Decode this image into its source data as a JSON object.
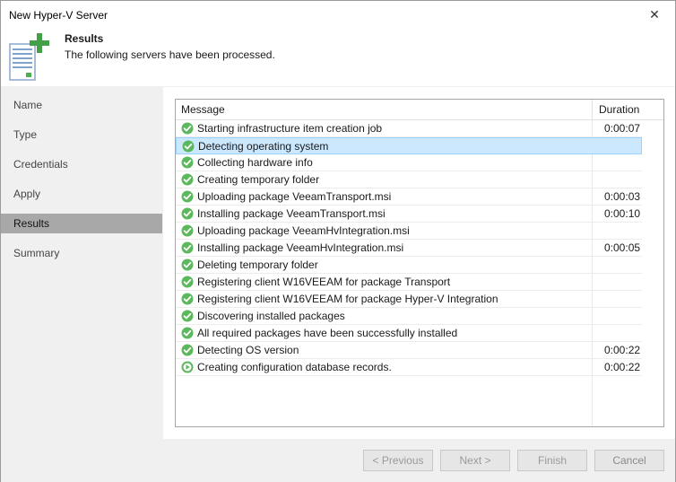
{
  "window": {
    "title": "New Hyper-V Server",
    "close_glyph": "✕"
  },
  "header": {
    "title": "Results",
    "subtitle": "The following servers have been processed.",
    "icon": "server-add-icon"
  },
  "sidebar": {
    "items": [
      {
        "label": "Name",
        "active": false
      },
      {
        "label": "Type",
        "active": false
      },
      {
        "label": "Credentials",
        "active": false
      },
      {
        "label": "Apply",
        "active": false
      },
      {
        "label": "Results",
        "active": true
      },
      {
        "label": "Summary",
        "active": false
      }
    ]
  },
  "table": {
    "columns": {
      "message": "Message",
      "duration": "Duration"
    },
    "rows": [
      {
        "message": "Starting infrastructure item creation job",
        "duration": "0:00:07",
        "status": "success"
      },
      {
        "message": "Detecting operating system",
        "duration": "",
        "status": "success",
        "selected": true
      },
      {
        "message": "Collecting hardware info",
        "duration": "",
        "status": "success"
      },
      {
        "message": "Creating temporary folder",
        "duration": "",
        "status": "success"
      },
      {
        "message": "Uploading package VeeamTransport.msi",
        "duration": "0:00:03",
        "status": "success"
      },
      {
        "message": "Installing package VeeamTransport.msi",
        "duration": "0:00:10",
        "status": "success"
      },
      {
        "message": "Uploading package VeeamHvIntegration.msi",
        "duration": "",
        "status": "success"
      },
      {
        "message": "Installing package VeeamHvIntegration.msi",
        "duration": "0:00:05",
        "status": "success"
      },
      {
        "message": "Deleting temporary folder",
        "duration": "",
        "status": "success"
      },
      {
        "message": "Registering client W16VEEAM for package Transport",
        "duration": "",
        "status": "success"
      },
      {
        "message": "Registering client W16VEEAM for package Hyper-V Integration",
        "duration": "",
        "status": "success"
      },
      {
        "message": "Discovering installed packages",
        "duration": "",
        "status": "success"
      },
      {
        "message": "All required packages have been successfully installed",
        "duration": "",
        "status": "success"
      },
      {
        "message": "Detecting OS version",
        "duration": "0:00:22",
        "status": "success"
      },
      {
        "message": "Creating configuration database records.",
        "duration": "0:00:22",
        "status": "running"
      }
    ]
  },
  "footer": {
    "previous": "< Previous",
    "next": "Next >",
    "finish": "Finish",
    "cancel": "Cancel"
  },
  "colors": {
    "success": "#5cb85c",
    "selected_bg": "#cce8ff",
    "active_nav": "#a8a8a8"
  }
}
